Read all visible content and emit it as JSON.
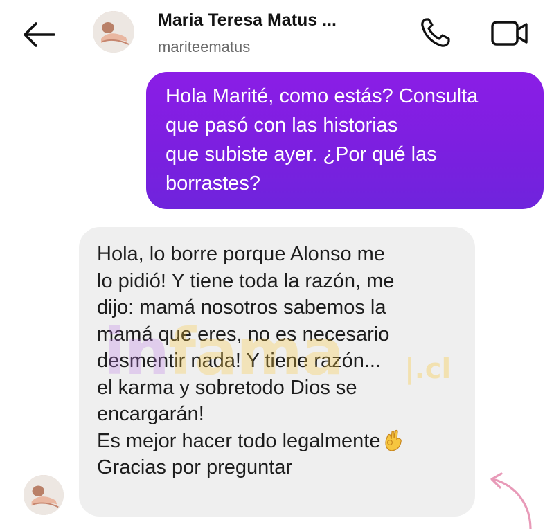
{
  "header": {
    "contact_name": "Maria Teresa Matus ...",
    "contact_handle": "mariteematus",
    "icons": {
      "back": "arrow-left-icon",
      "avatar": "profile-photo",
      "call": "phone-icon",
      "video": "video-camera-icon"
    }
  },
  "messages": [
    {
      "direction": "outgoing",
      "lines": [
        "Hola Marité, como estás? Consulta",
        "que pasó con las historias",
        "que subiste ayer. ¿Por qué las",
        "borrastes?"
      ]
    },
    {
      "direction": "incoming",
      "lines": [
        "Hola, lo borre porque Alonso me",
        "lo pidió! Y tiene toda la razón, me",
        "dijo: mamá nosotros sabemos la",
        "mamá que eres, no es necesario",
        "desmentir nada! Y tiene razón...",
        "el karma y sobretodo Dios se",
        "encargarán!",
        "Es mejor hacer todo legalmente",
        "Gracias por preguntar"
      ],
      "emoji_after_line_8": "ok-hand-emoji"
    }
  ],
  "watermark": {
    "part1": "in",
    "part2": "fama",
    "suffix": "|.cl"
  },
  "colors": {
    "outgoing_bubble": "#7c1fe0",
    "incoming_bubble": "#efefef",
    "annotation_arrow": "#e89ab8"
  }
}
